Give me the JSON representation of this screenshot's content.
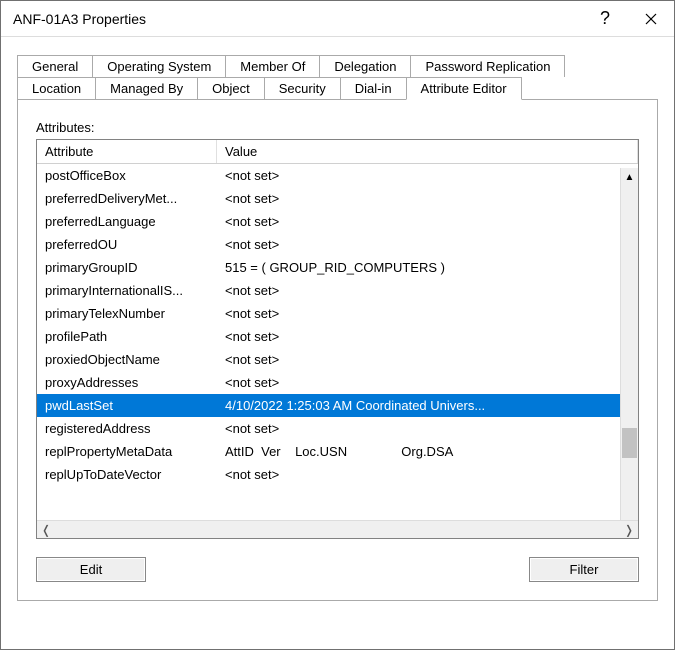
{
  "window": {
    "title": "ANF-01A3 Properties"
  },
  "tabs": {
    "row1": [
      {
        "label": "General"
      },
      {
        "label": "Operating System"
      },
      {
        "label": "Member Of"
      },
      {
        "label": "Delegation"
      },
      {
        "label": "Password Replication"
      }
    ],
    "row2": [
      {
        "label": "Location"
      },
      {
        "label": "Managed By"
      },
      {
        "label": "Object"
      },
      {
        "label": "Security"
      },
      {
        "label": "Dial-in"
      },
      {
        "label": "Attribute Editor",
        "active": true
      }
    ]
  },
  "panel": {
    "attributes_label": "Attributes:",
    "columns": {
      "attr": "Attribute",
      "val": "Value"
    },
    "rows": [
      {
        "attr": "postOfficeBox",
        "val": "<not set>"
      },
      {
        "attr": "preferredDeliveryMet...",
        "val": "<not set>"
      },
      {
        "attr": "preferredLanguage",
        "val": "<not set>"
      },
      {
        "attr": "preferredOU",
        "val": "<not set>"
      },
      {
        "attr": "primaryGroupID",
        "val": "515 = ( GROUP_RID_COMPUTERS )"
      },
      {
        "attr": "primaryInternationalIS...",
        "val": "<not set>"
      },
      {
        "attr": "primaryTelexNumber",
        "val": "<not set>"
      },
      {
        "attr": "profilePath",
        "val": "<not set>"
      },
      {
        "attr": "proxiedObjectName",
        "val": "<not set>"
      },
      {
        "attr": "proxyAddresses",
        "val": "<not set>"
      },
      {
        "attr": "pwdLastSet",
        "val": "4/10/2022 1:25:03 AM Coordinated Univers...",
        "selected": true
      },
      {
        "attr": "registeredAddress",
        "val": "<not set>"
      },
      {
        "attr": "replPropertyMetaData",
        "val": "AttID  Ver    Loc.USN               Org.DSA"
      },
      {
        "attr": "replUpToDateVector",
        "val": "<not set>"
      }
    ],
    "buttons": {
      "edit": "Edit",
      "filter": "Filter"
    }
  }
}
